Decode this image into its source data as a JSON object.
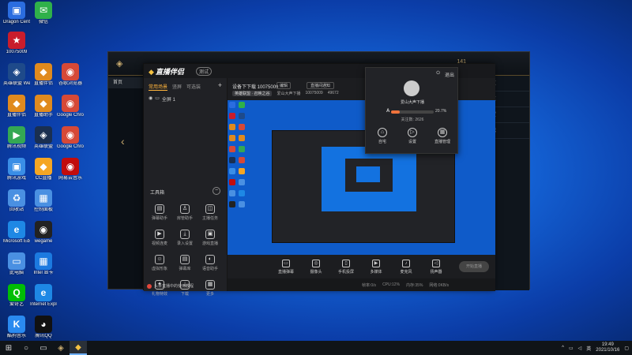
{
  "desktop": {
    "icons": [
      {
        "label": "Dragon Center",
        "glyph": "▣",
        "color": "#2b6de0"
      },
      {
        "label": "微信",
        "glyph": "✉",
        "color": "#2fb14a"
      },
      {
        "label": "10075009",
        "glyph": "★",
        "color": "#c91d2c"
      },
      {
        "label": "英雄联盟 WeGame版",
        "glyph": "◈",
        "color": "#1e4a8a"
      },
      {
        "label": "直播伴侣",
        "glyph": "◆",
        "color": "#e08a1e"
      },
      {
        "label": "谷歌浏览器",
        "glyph": "◉",
        "color": "#d64937"
      },
      {
        "label": "直播伴侣",
        "glyph": "◆",
        "color": "#e08a1e"
      },
      {
        "label": "直播助手",
        "glyph": "◆",
        "color": "#e08a1e"
      },
      {
        "label": "Google Chrome",
        "glyph": "◉",
        "color": "#d64937"
      },
      {
        "label": "腾讯视频",
        "glyph": "▶",
        "color": "#34a853"
      },
      {
        "label": "英雄联盟",
        "glyph": "◈",
        "color": "#1a2f50"
      },
      {
        "label": "Google Chrome",
        "glyph": "◉",
        "color": "#d64937"
      },
      {
        "label": "腾讯游戏",
        "glyph": "▣",
        "color": "#3a8ee6"
      },
      {
        "label": "CC直播",
        "glyph": "◆",
        "color": "#f5a623"
      },
      {
        "label": "网易云音乐",
        "glyph": "◉",
        "color": "#c20c0c"
      },
      {
        "label": "回收站",
        "glyph": "♻",
        "color": "#4a90e2"
      },
      {
        "label": "控制面板",
        "glyph": "▦",
        "color": "#4a90e2"
      },
      {
        "label": "Microsoft Edge",
        "glyph": "e",
        "color": "#1e88e5"
      },
      {
        "label": "wegame",
        "glyph": "◉",
        "color": "#222"
      },
      {
        "label": "此电脑",
        "glyph": "▭",
        "color": "#4a90e2"
      },
      {
        "label": "Intel 显卡",
        "glyph": "▦",
        "color": "#1c7ae0"
      },
      {
        "label": "爱奇艺",
        "glyph": "Q",
        "color": "#00be06"
      },
      {
        "label": "Internet Explorer",
        "glyph": "e",
        "color": "#1e88e5"
      },
      {
        "label": "酷狗音乐",
        "glyph": "K",
        "color": "#2a8af0"
      },
      {
        "label": "腾讯QQ",
        "glyph": "◕",
        "color": "#111"
      }
    ]
  },
  "game": {
    "nav_home": "首页",
    "coins": "141",
    "right_labels": [
      "好友",
      "主页",
      "设置",
      "游戏"
    ]
  },
  "app": {
    "logo": "直播伴侣",
    "version": "测试",
    "tabs": [
      "常用场景",
      "竖屏",
      "可选装",
      "+"
    ],
    "scene_label": "全屏 1",
    "toolbox_title": "工具箱",
    "tools": [
      "弹幕助手",
      "房管助手",
      "主播任务",
      "视频连麦",
      "录入设置",
      "游戏直播",
      "虚拟形象",
      "弹幕库",
      "语音助手",
      "礼物特效",
      "下载",
      "更多"
    ],
    "notice": "头条直播中的使用教程",
    "room_title": "设备下下载 10075009",
    "edit_label": "编辑",
    "notice_label": "直播间通知",
    "tags": [
      "英雄联盟 · 召唤之谷",
      "爱山大声下播",
      "10075009",
      "49672"
    ],
    "bottom_tools": [
      "直播弹幕",
      "摄像头",
      "手机投屏",
      "多媒体",
      "麦克风",
      "扬声器"
    ],
    "start_label": "开始直播",
    "status": [
      "帧率:0/s",
      "CPU:12%",
      "内存:35%",
      "网络:0KB/s"
    ]
  },
  "popup": {
    "name": "爱山大声下播",
    "level_mark": "A",
    "progress_percent": 20.7,
    "progress_text": "20.7%",
    "follow": "关注数: 2626",
    "actions": [
      "自宅",
      "设置",
      "直播管理"
    ],
    "exit": "退出"
  },
  "taskbar": {
    "time": "19:49",
    "date": "2021/10/16",
    "lang": "英"
  }
}
